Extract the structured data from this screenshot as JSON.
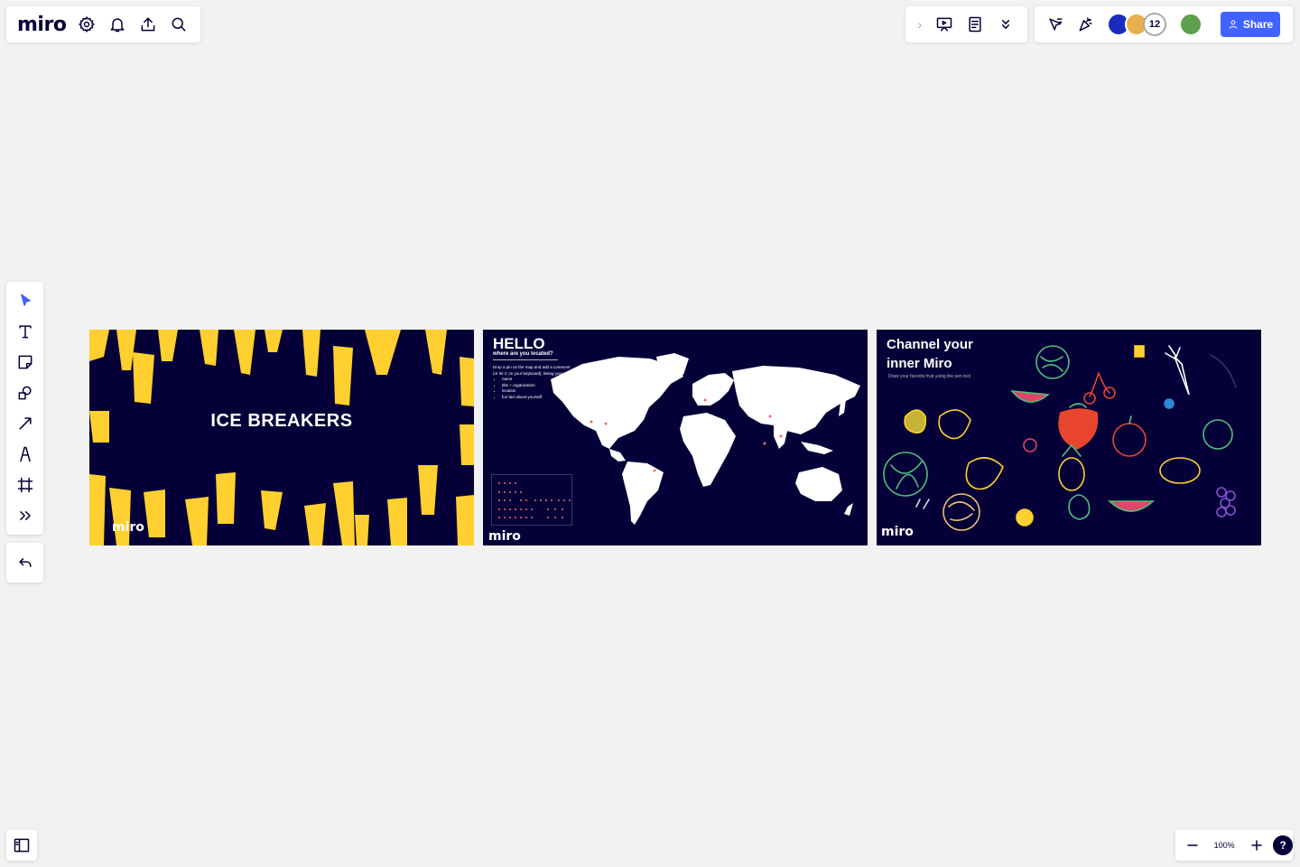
{
  "app": {
    "logo": "miro"
  },
  "header": {
    "share_label": "Share",
    "collaborator_count": "12"
  },
  "zoom": {
    "level": "100%",
    "help": "?"
  },
  "frames": [
    {
      "title": "ICE BREAKERS",
      "logo": "miro"
    },
    {
      "title": "HELLO",
      "subtitle": "where are you located?",
      "instruction": "Drop a pin on the map and add a comment (or hit C on your keyboard), listing your:",
      "bullets": [
        "name",
        "title + organization",
        "location",
        "fun fact about yourself"
      ],
      "logo": "miro"
    },
    {
      "title_line1": "Channel your",
      "title_line2": "inner Miro",
      "subtitle": "Draw your favorite fruit using the pen tool",
      "logo": "miro"
    }
  ],
  "colors": {
    "frame_bg": "#050038",
    "accent_yellow": "#ffd02f",
    "share_blue": "#4262ff",
    "canvas_bg": "#f2f2f2"
  },
  "icons": {
    "top_left": [
      "settings-icon",
      "bell-icon",
      "upload-icon",
      "search-icon"
    ],
    "top_mid": [
      "chevron-right-icon",
      "presentation-icon",
      "notes-icon",
      "double-chevron-down-icon"
    ],
    "top_right": [
      "cursor-share-icon",
      "celebrate-icon"
    ],
    "toolbar": [
      "select-icon",
      "text-icon",
      "sticky-note-icon",
      "shapes-icon",
      "connector-icon",
      "pen-icon",
      "frame-icon",
      "more-tools-icon"
    ],
    "bottom": [
      "undo-icon",
      "board-panel-icon",
      "zoom-out-icon",
      "zoom-in-icon",
      "help-icon"
    ]
  }
}
